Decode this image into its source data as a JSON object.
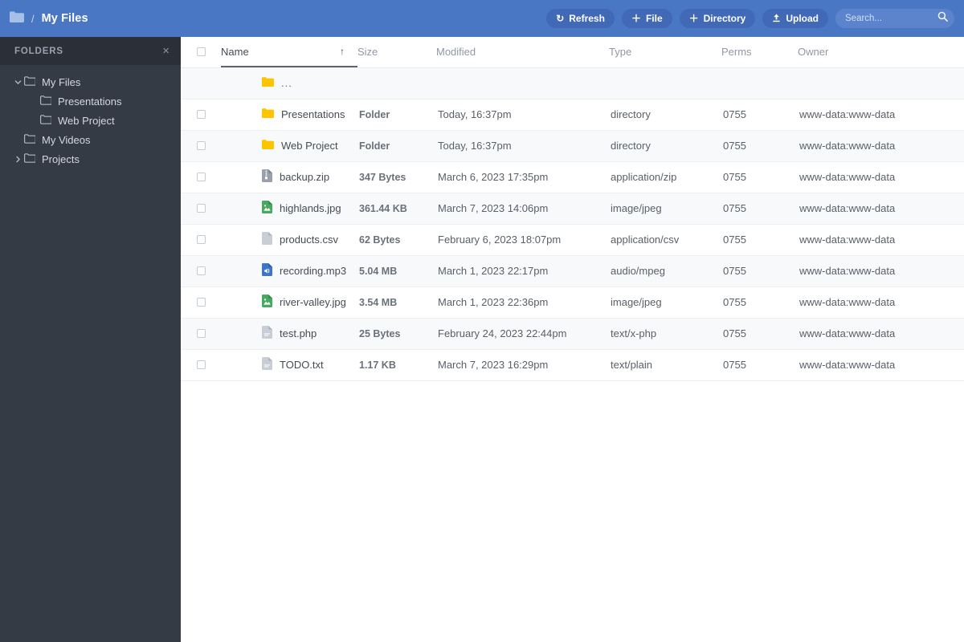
{
  "header": {
    "breadcrumb_icon": "folder-icon",
    "breadcrumb_separator": "/",
    "breadcrumb_title": "My Files",
    "accent_color": "#4a77c4",
    "button_color": "#4169b5",
    "toolbar": [
      {
        "id": "refresh",
        "label": "Refresh",
        "icon": "refresh-icon",
        "glyph": "↻"
      },
      {
        "id": "file",
        "label": "File",
        "icon": "plus-icon",
        "glyph": "＋"
      },
      {
        "id": "directory",
        "label": "Directory",
        "icon": "plus-icon",
        "glyph": "＋"
      },
      {
        "id": "upload",
        "label": "Upload",
        "icon": "upload-icon",
        "glyph": "⬆"
      }
    ],
    "search": {
      "placeholder": "Search...",
      "value": "",
      "icon": "search-icon"
    }
  },
  "sidebar": {
    "title": "FOLDERS",
    "close_label": "×",
    "background": "#353b45",
    "items": [
      {
        "label": "My Files",
        "depth": 0,
        "expanded": true,
        "chevron": "chevron-down-icon"
      },
      {
        "label": "Presentations",
        "depth": 1,
        "expanded": null,
        "chevron": "none"
      },
      {
        "label": "Web Project",
        "depth": 1,
        "expanded": null,
        "chevron": "none"
      },
      {
        "label": "My Videos",
        "depth": 0,
        "expanded": null,
        "chevron": "none"
      },
      {
        "label": "Projects",
        "depth": 0,
        "expanded": false,
        "chevron": "chevron-right-icon"
      }
    ]
  },
  "table": {
    "select_all_checked": false,
    "sort_column": "Name",
    "sort_direction": "asc",
    "sort_arrow": "↑",
    "columns": [
      {
        "key": "name",
        "label": "Name"
      },
      {
        "key": "size",
        "label": "Size"
      },
      {
        "key": "mod",
        "label": "Modified"
      },
      {
        "key": "type",
        "label": "Type"
      },
      {
        "key": "perms",
        "label": "Perms"
      },
      {
        "key": "owner",
        "label": "Owner"
      }
    ],
    "parent_row": {
      "name": "...",
      "icon": "folder-icon",
      "size": "",
      "mod": "",
      "type": "",
      "perms": "",
      "owner": "",
      "checkbox": false
    },
    "rows": [
      {
        "name": "Presentations",
        "icon": "folder-icon",
        "size": "Folder",
        "mod": "Today, 16:37pm",
        "type": "directory",
        "perms": "0755",
        "owner": "www-data:www-data"
      },
      {
        "name": "Web Project",
        "icon": "folder-icon",
        "size": "Folder",
        "mod": "Today, 16:37pm",
        "type": "directory",
        "perms": "0755",
        "owner": "www-data:www-data"
      },
      {
        "name": "backup.zip",
        "icon": "archive-icon",
        "size": "347 Bytes",
        "mod": "March 6, 2023 17:35pm",
        "type": "application/zip",
        "perms": "0755",
        "owner": "www-data:www-data"
      },
      {
        "name": "highlands.jpg",
        "icon": "image-icon",
        "size": "361.44 KB",
        "mod": "March 7, 2023 14:06pm",
        "type": "image/jpeg",
        "perms": "0755",
        "owner": "www-data:www-data"
      },
      {
        "name": "products.csv",
        "icon": "file-icon",
        "size": "62 Bytes",
        "mod": "February 6, 2023 18:07pm",
        "type": "application/csv",
        "perms": "0755",
        "owner": "www-data:www-data"
      },
      {
        "name": "recording.mp3",
        "icon": "audio-icon",
        "size": "5.04 MB",
        "mod": "March 1, 2023 22:17pm",
        "type": "audio/mpeg",
        "perms": "0755",
        "owner": "www-data:www-data"
      },
      {
        "name": "river-valley.jpg",
        "icon": "image-icon",
        "size": "3.54 MB",
        "mod": "March 1, 2023 22:36pm",
        "type": "image/jpeg",
        "perms": "0755",
        "owner": "www-data:www-data"
      },
      {
        "name": "test.php",
        "icon": "code-icon",
        "size": "25 Bytes",
        "mod": "February 24, 2023 22:44pm",
        "type": "text/x-php",
        "perms": "0755",
        "owner": "www-data:www-data"
      },
      {
        "name": "TODO.txt",
        "icon": "text-icon",
        "size": "1.17 KB",
        "mod": "March 7, 2023 16:29pm",
        "type": "text/plain",
        "perms": "0755",
        "owner": "www-data:www-data"
      }
    ]
  }
}
